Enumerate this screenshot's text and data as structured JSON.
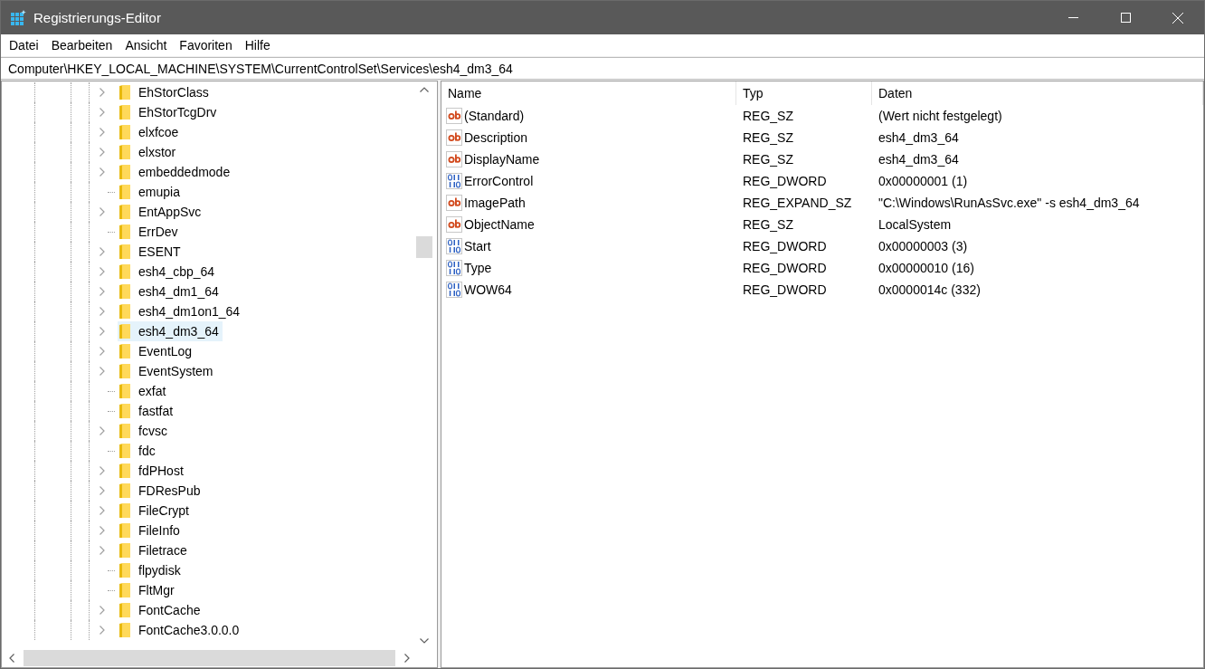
{
  "window": {
    "title": "Registrierungs-Editor"
  },
  "menu": [
    "Datei",
    "Bearbeiten",
    "Ansicht",
    "Favoriten",
    "Hilfe"
  ],
  "address": "Computer\\HKEY_LOCAL_MACHINE\\SYSTEM\\CurrentControlSet\\Services\\esh4_dm3_64",
  "tree": [
    {
      "label": "EhStorClass",
      "kind": "expandable",
      "selected": false
    },
    {
      "label": "EhStorTcgDrv",
      "kind": "expandable",
      "selected": false
    },
    {
      "label": "elxfcoe",
      "kind": "expandable",
      "selected": false
    },
    {
      "label": "elxstor",
      "kind": "expandable",
      "selected": false
    },
    {
      "label": "embeddedmode",
      "kind": "expandable",
      "selected": false
    },
    {
      "label": "emupia",
      "kind": "leaf",
      "selected": false
    },
    {
      "label": "EntAppSvc",
      "kind": "expandable",
      "selected": false
    },
    {
      "label": "ErrDev",
      "kind": "leaf",
      "selected": false
    },
    {
      "label": "ESENT",
      "kind": "expandable",
      "selected": false
    },
    {
      "label": "esh4_cbp_64",
      "kind": "expandable",
      "selected": false
    },
    {
      "label": "esh4_dm1_64",
      "kind": "expandable",
      "selected": false
    },
    {
      "label": "esh4_dm1on1_64",
      "kind": "expandable",
      "selected": false
    },
    {
      "label": "esh4_dm3_64",
      "kind": "expandable",
      "selected": true
    },
    {
      "label": "EventLog",
      "kind": "expandable",
      "selected": false
    },
    {
      "label": "EventSystem",
      "kind": "expandable",
      "selected": false
    },
    {
      "label": "exfat",
      "kind": "leaf",
      "selected": false
    },
    {
      "label": "fastfat",
      "kind": "leaf",
      "selected": false
    },
    {
      "label": "fcvsc",
      "kind": "expandable",
      "selected": false
    },
    {
      "label": "fdc",
      "kind": "leaf",
      "selected": false
    },
    {
      "label": "fdPHost",
      "kind": "expandable",
      "selected": false
    },
    {
      "label": "FDResPub",
      "kind": "expandable",
      "selected": false
    },
    {
      "label": "FileCrypt",
      "kind": "expandable",
      "selected": false
    },
    {
      "label": "FileInfo",
      "kind": "expandable",
      "selected": false
    },
    {
      "label": "Filetrace",
      "kind": "expandable",
      "selected": false
    },
    {
      "label": "flpydisk",
      "kind": "leaf",
      "selected": false
    },
    {
      "label": "FltMgr",
      "kind": "leaf",
      "selected": false
    },
    {
      "label": "FontCache",
      "kind": "expandable",
      "selected": false
    },
    {
      "label": "FontCache3.0.0.0",
      "kind": "expandable",
      "selected": false
    }
  ],
  "table": {
    "columns": [
      "Name",
      "Typ",
      "Daten"
    ],
    "rows": [
      {
        "kind": "string",
        "name": "(Standard)",
        "type": "REG_SZ",
        "data": "(Wert nicht festgelegt)"
      },
      {
        "kind": "string",
        "name": "Description",
        "type": "REG_SZ",
        "data": "esh4_dm3_64"
      },
      {
        "kind": "string",
        "name": "DisplayName",
        "type": "REG_SZ",
        "data": "esh4_dm3_64"
      },
      {
        "kind": "binary",
        "name": "ErrorControl",
        "type": "REG_DWORD",
        "data": "0x00000001 (1)"
      },
      {
        "kind": "string",
        "name": "ImagePath",
        "type": "REG_EXPAND_SZ",
        "data": "\"C:\\Windows\\RunAsSvc.exe\" -s esh4_dm3_64"
      },
      {
        "kind": "string",
        "name": "ObjectName",
        "type": "REG_SZ",
        "data": "LocalSystem"
      },
      {
        "kind": "binary",
        "name": "Start",
        "type": "REG_DWORD",
        "data": "0x00000003 (3)"
      },
      {
        "kind": "binary",
        "name": "Type",
        "type": "REG_DWORD",
        "data": "0x00000010 (16)"
      },
      {
        "kind": "binary",
        "name": "WOW64",
        "type": "REG_DWORD",
        "data": "0x0000014c (332)"
      }
    ]
  }
}
